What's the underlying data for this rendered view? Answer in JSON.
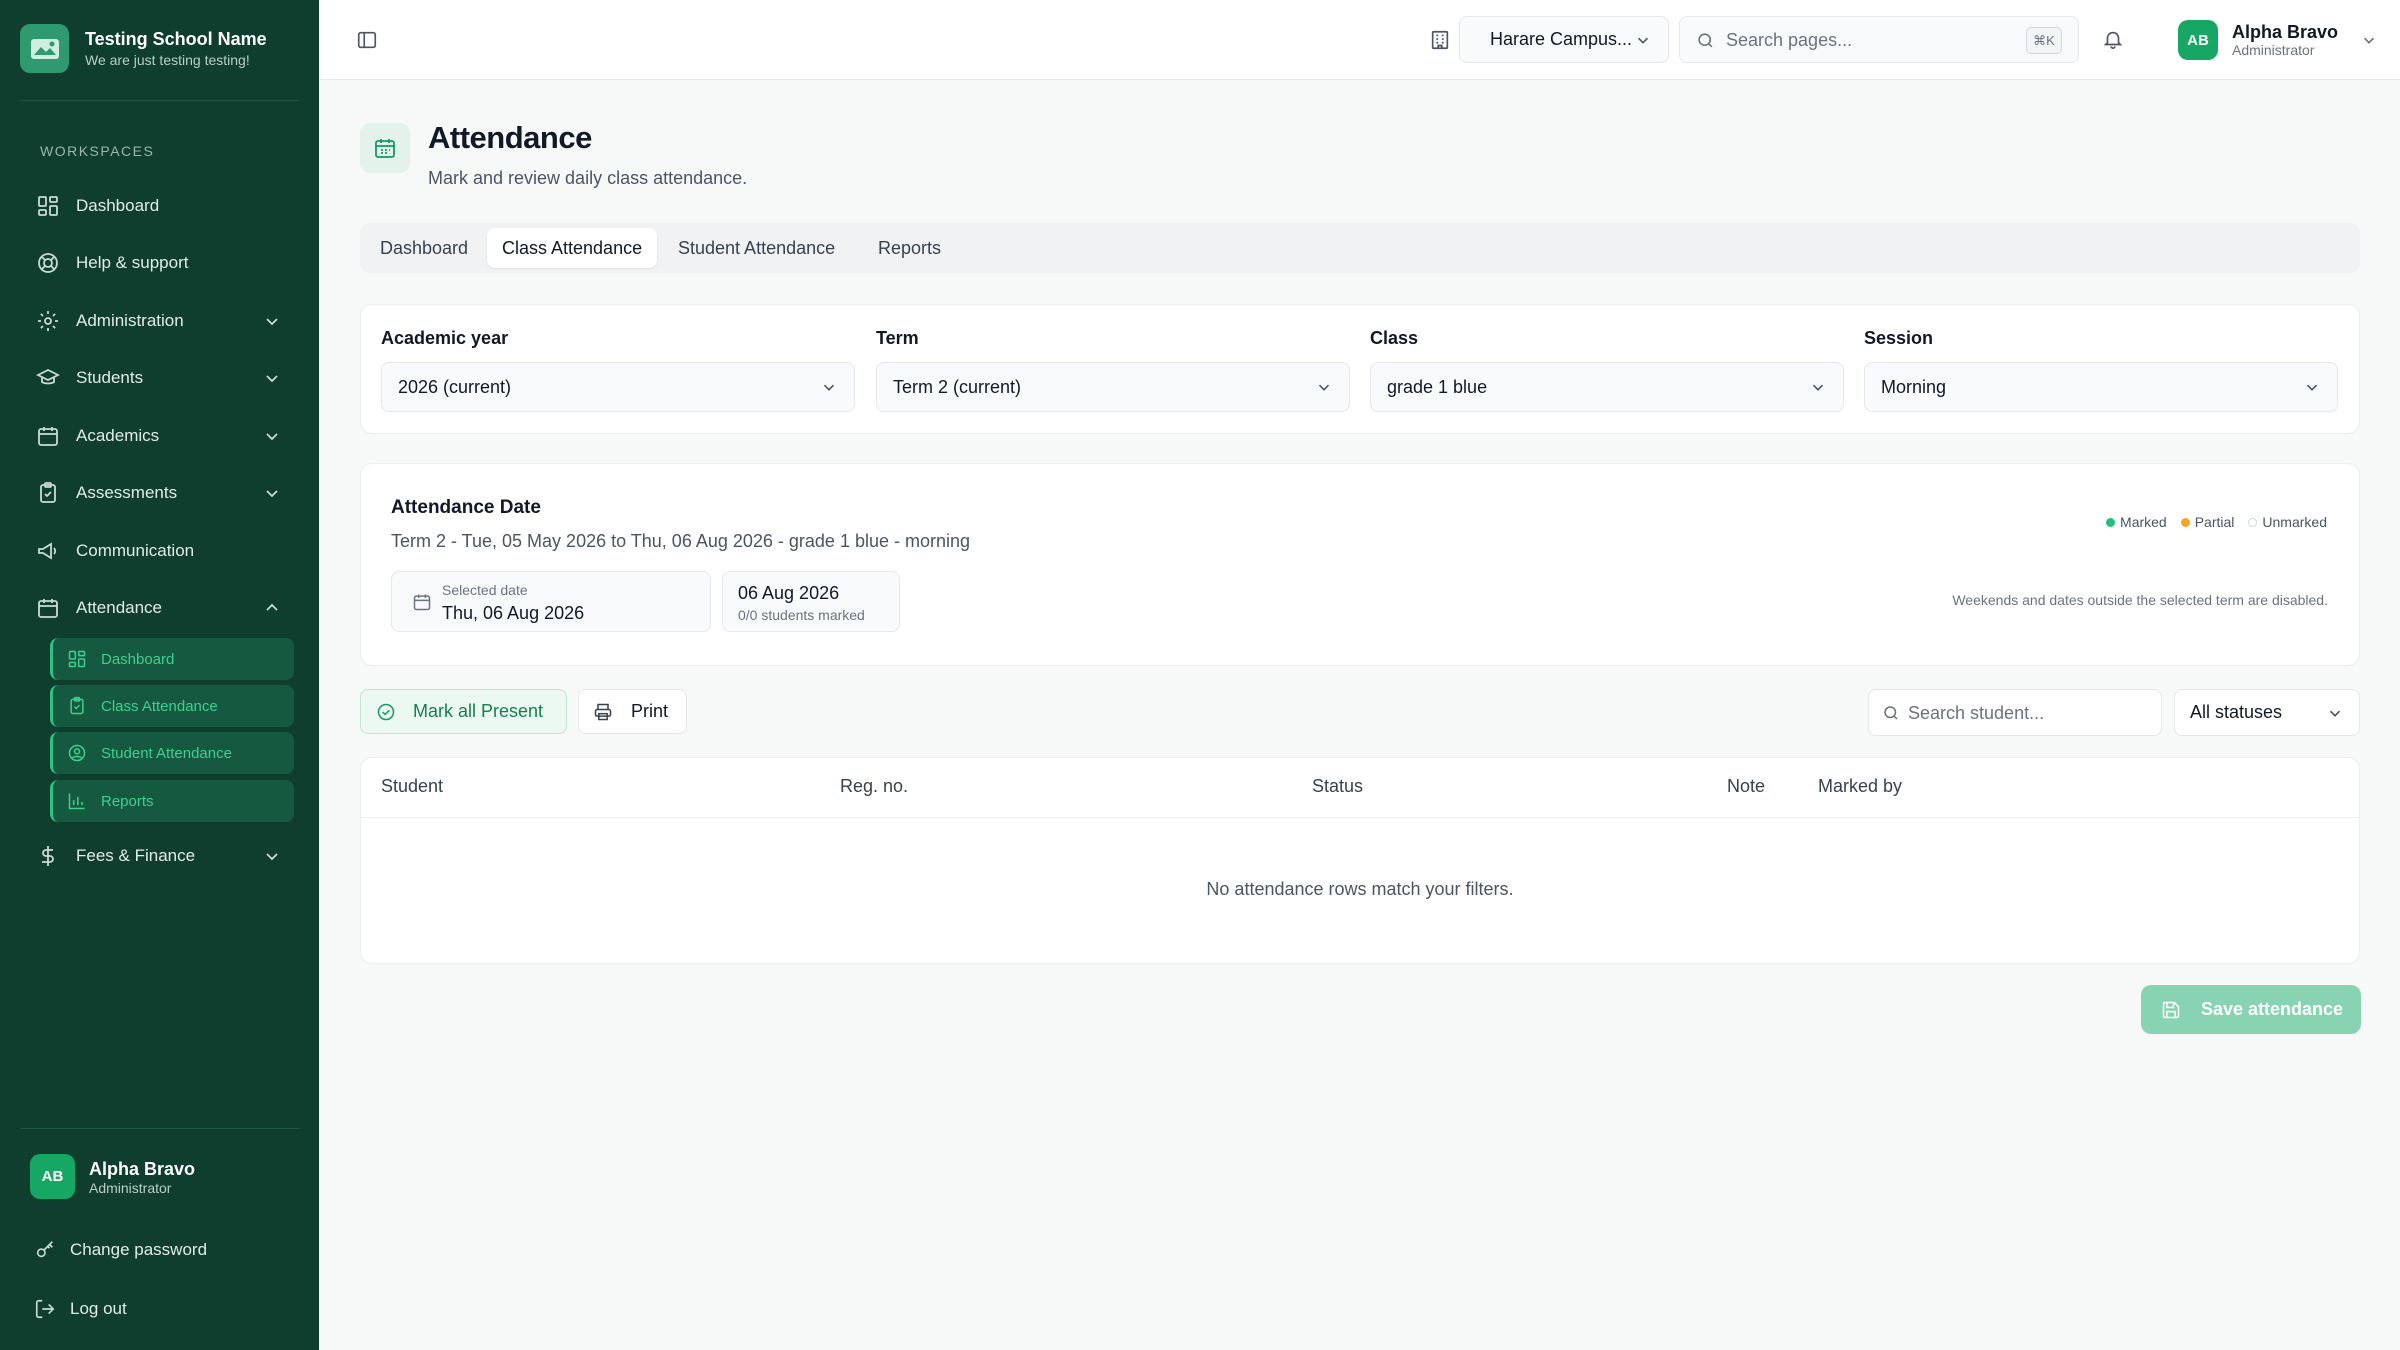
{
  "brand": {
    "name": "Testing School Name",
    "tagline": "We are just testing testing!"
  },
  "sidebar": {
    "section_label": "WORKSPACES",
    "items": [
      {
        "label": "Dashboard",
        "icon": "dashboard-icon"
      },
      {
        "label": "Help & support",
        "icon": "lifebuoy-icon"
      },
      {
        "label": "Administration",
        "icon": "gear-icon"
      },
      {
        "label": "Students",
        "icon": "graduation-cap-icon"
      },
      {
        "label": "Academics",
        "icon": "calendar-icon"
      },
      {
        "label": "Assessments",
        "icon": "clipboard-check-icon"
      },
      {
        "label": "Communication",
        "icon": "megaphone-icon"
      },
      {
        "label": "Attendance",
        "icon": "calendar-icon"
      },
      {
        "label": "Fees & Finance",
        "icon": "dollar-icon"
      }
    ],
    "attendance_sub": [
      {
        "label": "Dashboard",
        "icon": "dashboard-icon"
      },
      {
        "label": "Class Attendance",
        "icon": "clipboard-icon"
      },
      {
        "label": "Student Attendance",
        "icon": "user-circle-icon"
      },
      {
        "label": "Reports",
        "icon": "bar-chart-icon"
      }
    ],
    "user": {
      "initials": "AB",
      "name": "Alpha Bravo",
      "role": "Administrator"
    },
    "change_password": "Change password",
    "logout": "Log out"
  },
  "topbar": {
    "campus": "Harare Campus...",
    "search_placeholder": "Search pages...",
    "shortcut": "⌘K",
    "user": {
      "initials": "AB",
      "name": "Alpha Bravo",
      "role": "Administrator"
    }
  },
  "page": {
    "title": "Attendance",
    "subtitle": "Mark and review daily class attendance."
  },
  "tabs": [
    {
      "label": "Dashboard"
    },
    {
      "label": "Class Attendance",
      "active": true
    },
    {
      "label": "Student Attendance"
    },
    {
      "label": "Reports"
    }
  ],
  "filters": {
    "academic_year": {
      "label": "Academic year",
      "value": "2026 (current)"
    },
    "term": {
      "label": "Term",
      "value": "Term 2 (current)"
    },
    "class": {
      "label": "Class",
      "value": "grade 1 blue"
    },
    "session": {
      "label": "Session",
      "value": "Morning"
    }
  },
  "attendance_date": {
    "title": "Attendance Date",
    "subtitle": "Term 2 - Tue, 05 May 2026 to Thu, 06 Aug 2026 - grade 1 blue - morning",
    "selected_label": "Selected date",
    "selected_value": "Thu, 06 Aug 2026",
    "short_date": "06 Aug 2026",
    "count": "0/0 students marked",
    "legend": [
      {
        "label": "Marked",
        "color": "#22c07a"
      },
      {
        "label": "Partial",
        "color": "#f5a524"
      },
      {
        "label": "Unmarked",
        "color": "#ffffff"
      }
    ],
    "hint": "Weekends and dates outside the selected term are disabled."
  },
  "toolbar": {
    "mark_all": "Mark all Present",
    "print": "Print",
    "search_placeholder": "Search student...",
    "status_filter": "All statuses"
  },
  "table": {
    "columns": [
      "Student",
      "Reg. no.",
      "Status",
      "Note",
      "Marked by"
    ],
    "empty": "No attendance rows match your filters."
  },
  "save_label": "Save attendance",
  "colors": {
    "sidebar": "#0f3d2e",
    "accent": "#17a765",
    "save_disabled": "#88d4b2"
  }
}
